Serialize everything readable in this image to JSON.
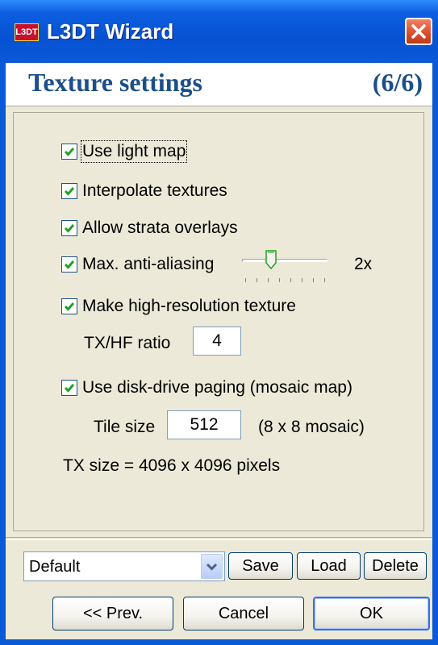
{
  "window": {
    "title": "L3DT Wizard",
    "icon_text": "L3DT"
  },
  "header": {
    "title": "Texture settings",
    "step": "(6/6)"
  },
  "options": {
    "use_light_map": {
      "label": "Use light map",
      "checked": true
    },
    "interpolate_textures": {
      "label": "Interpolate textures",
      "checked": true
    },
    "allow_strata_overlays": {
      "label": "Allow strata overlays",
      "checked": true
    },
    "max_anti_aliasing": {
      "label": "Max. anti-aliasing",
      "checked": true,
      "value_text": "2x"
    },
    "high_res_texture": {
      "label": "Make high-resolution texture",
      "checked": true
    },
    "tx_hf_ratio": {
      "label": "TX/HF ratio",
      "value": "4"
    },
    "disk_paging": {
      "label": "Use disk-drive paging (mosaic map)",
      "checked": true
    },
    "tile_size": {
      "label": "Tile size",
      "value": "512",
      "note": "(8 x 8 mosaic)"
    },
    "tx_size": "TX size = 4096 x 4096 pixels"
  },
  "preset": {
    "selected": "Default",
    "save_label": "Save",
    "load_label": "Load",
    "delete_label": "Delete"
  },
  "buttons": {
    "prev_label": "<< Prev.",
    "cancel_label": "Cancel",
    "ok_label": "OK"
  },
  "colors": {
    "titlebar": "#0a5ad8",
    "dialog_bg": "#ece9d8",
    "header_text": "#1b4f8a",
    "checkmark": "#21a121"
  }
}
